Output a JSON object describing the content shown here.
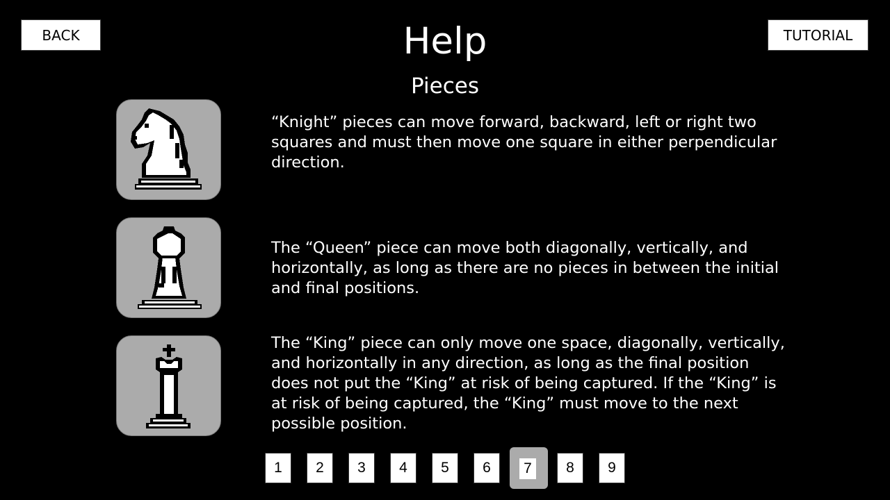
{
  "header": {
    "back_label": "BACK",
    "title": "Help",
    "subtitle": "Pieces",
    "tutorial_label": "TUTORIAL"
  },
  "pieces": [
    {
      "icon": "knight-icon",
      "description": "“Knight” pieces can move forward, backward, left or right two squares and must then move one square in either perpendicular direction."
    },
    {
      "icon": "queen-icon",
      "description": "The “Queen” piece can move both diagonally, vertically, and horizontally, as long as there are no pieces in between the initial and final positions."
    },
    {
      "icon": "king-icon",
      "description": "The “King” piece can only move one space, diagonally, vertically, and horizontally in any direction, as long as the final position does not put the “King” at risk of being captured. If the “King” is at risk of being captured, the “King” must move to the next possible position."
    }
  ],
  "pagination": {
    "pages": [
      "1",
      "2",
      "3",
      "4",
      "5",
      "6",
      "7",
      "8",
      "9"
    ],
    "active": "7"
  },
  "colors": {
    "background": "#000000",
    "panel": "#ababab",
    "text": "#ffffff",
    "button": "#ffffff"
  }
}
